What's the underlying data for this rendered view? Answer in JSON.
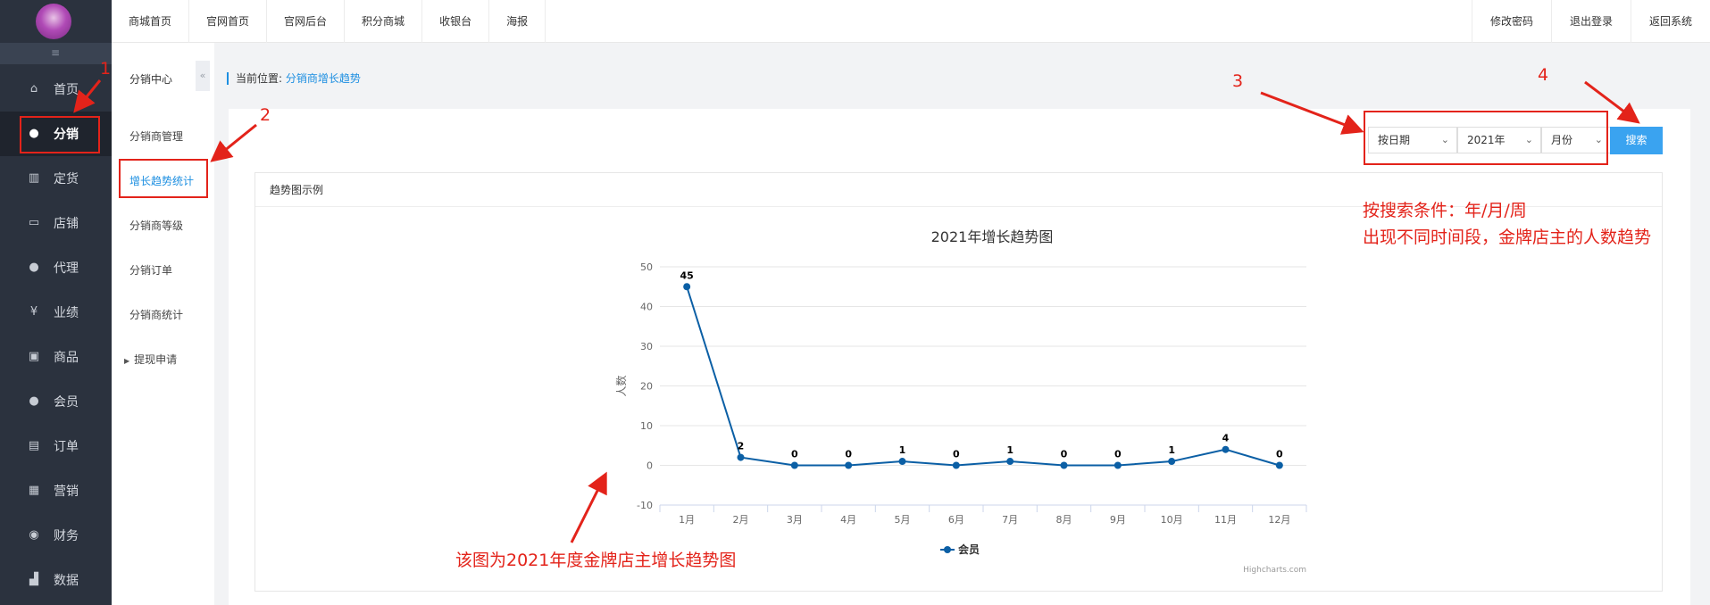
{
  "sidebar": {
    "items": [
      {
        "icon": "home-icon",
        "glyph": "⌂",
        "label": "首页"
      },
      {
        "icon": "user-icon",
        "glyph": "●",
        "label": "分销"
      },
      {
        "icon": "bar-chart-icon",
        "glyph": "▥",
        "label": "定货"
      },
      {
        "icon": "store-icon",
        "glyph": "▭",
        "label": "店铺"
      },
      {
        "icon": "agent-icon",
        "glyph": "●",
        "label": "代理"
      },
      {
        "icon": "yen-icon",
        "glyph": "¥",
        "label": "业绩"
      },
      {
        "icon": "goods-icon",
        "glyph": "▣",
        "label": "商品"
      },
      {
        "icon": "member-icon",
        "glyph": "●",
        "label": "会员"
      },
      {
        "icon": "order-icon",
        "glyph": "▤",
        "label": "订单"
      },
      {
        "icon": "gift-icon",
        "glyph": "▦",
        "label": "营销"
      },
      {
        "icon": "finance-icon",
        "glyph": "◉",
        "label": "财务"
      },
      {
        "icon": "data-icon",
        "glyph": "▟",
        "label": "数据"
      }
    ],
    "active_index": 1
  },
  "topbar": {
    "left": [
      "商城首页",
      "官网首页",
      "官网后台",
      "积分商城",
      "收银台",
      "海报"
    ],
    "right": [
      "修改密码",
      "退出登录",
      "返回系统"
    ]
  },
  "subnav": {
    "title": "分销中心",
    "items": [
      "分销商管理",
      "增长趋势统计",
      "分销商等级",
      "分销订单",
      "分销商统计",
      "提现申请"
    ],
    "active_index": 1
  },
  "breadcrumb": {
    "prefix": "当前位置:",
    "current": "分销商增长趋势"
  },
  "filters": {
    "mode": "按日期",
    "year": "2021年",
    "period": "月份",
    "search_label": "搜索"
  },
  "chart_card": {
    "header": "趋势图示例"
  },
  "chart_data": {
    "type": "line",
    "title": "2021年增长趋势图",
    "ylabel": "人数",
    "xlabel": "",
    "categories": [
      "1月",
      "2月",
      "3月",
      "4月",
      "5月",
      "6月",
      "7月",
      "8月",
      "9月",
      "10月",
      "11月",
      "12月"
    ],
    "series": [
      {
        "name": "会员",
        "values": [
          45,
          2,
          0,
          0,
          1,
          0,
          1,
          0,
          0,
          1,
          4,
          0
        ],
        "color": "#0b5fa5"
      }
    ],
    "ylim": [
      -10,
      50
    ],
    "yticks": [
      -10,
      0,
      10,
      20,
      30,
      40,
      50
    ],
    "grid": true,
    "legend": "bottom-center",
    "credits": "Highcharts.com"
  },
  "annotations": {
    "numbers": [
      "1",
      "2",
      "3",
      "4"
    ],
    "search_note_line1": "按搜索条件：年/月/周",
    "search_note_line2": "出现不同时间段，金牌店主的人数趋势",
    "chart_note": "该图为2021年度金牌店主增长趋势图",
    "color": "#e3231a"
  },
  "colors": {
    "sidebar_bg": "#2b323e",
    "accent": "#1d8fe1",
    "button": "#3aa3f0"
  }
}
